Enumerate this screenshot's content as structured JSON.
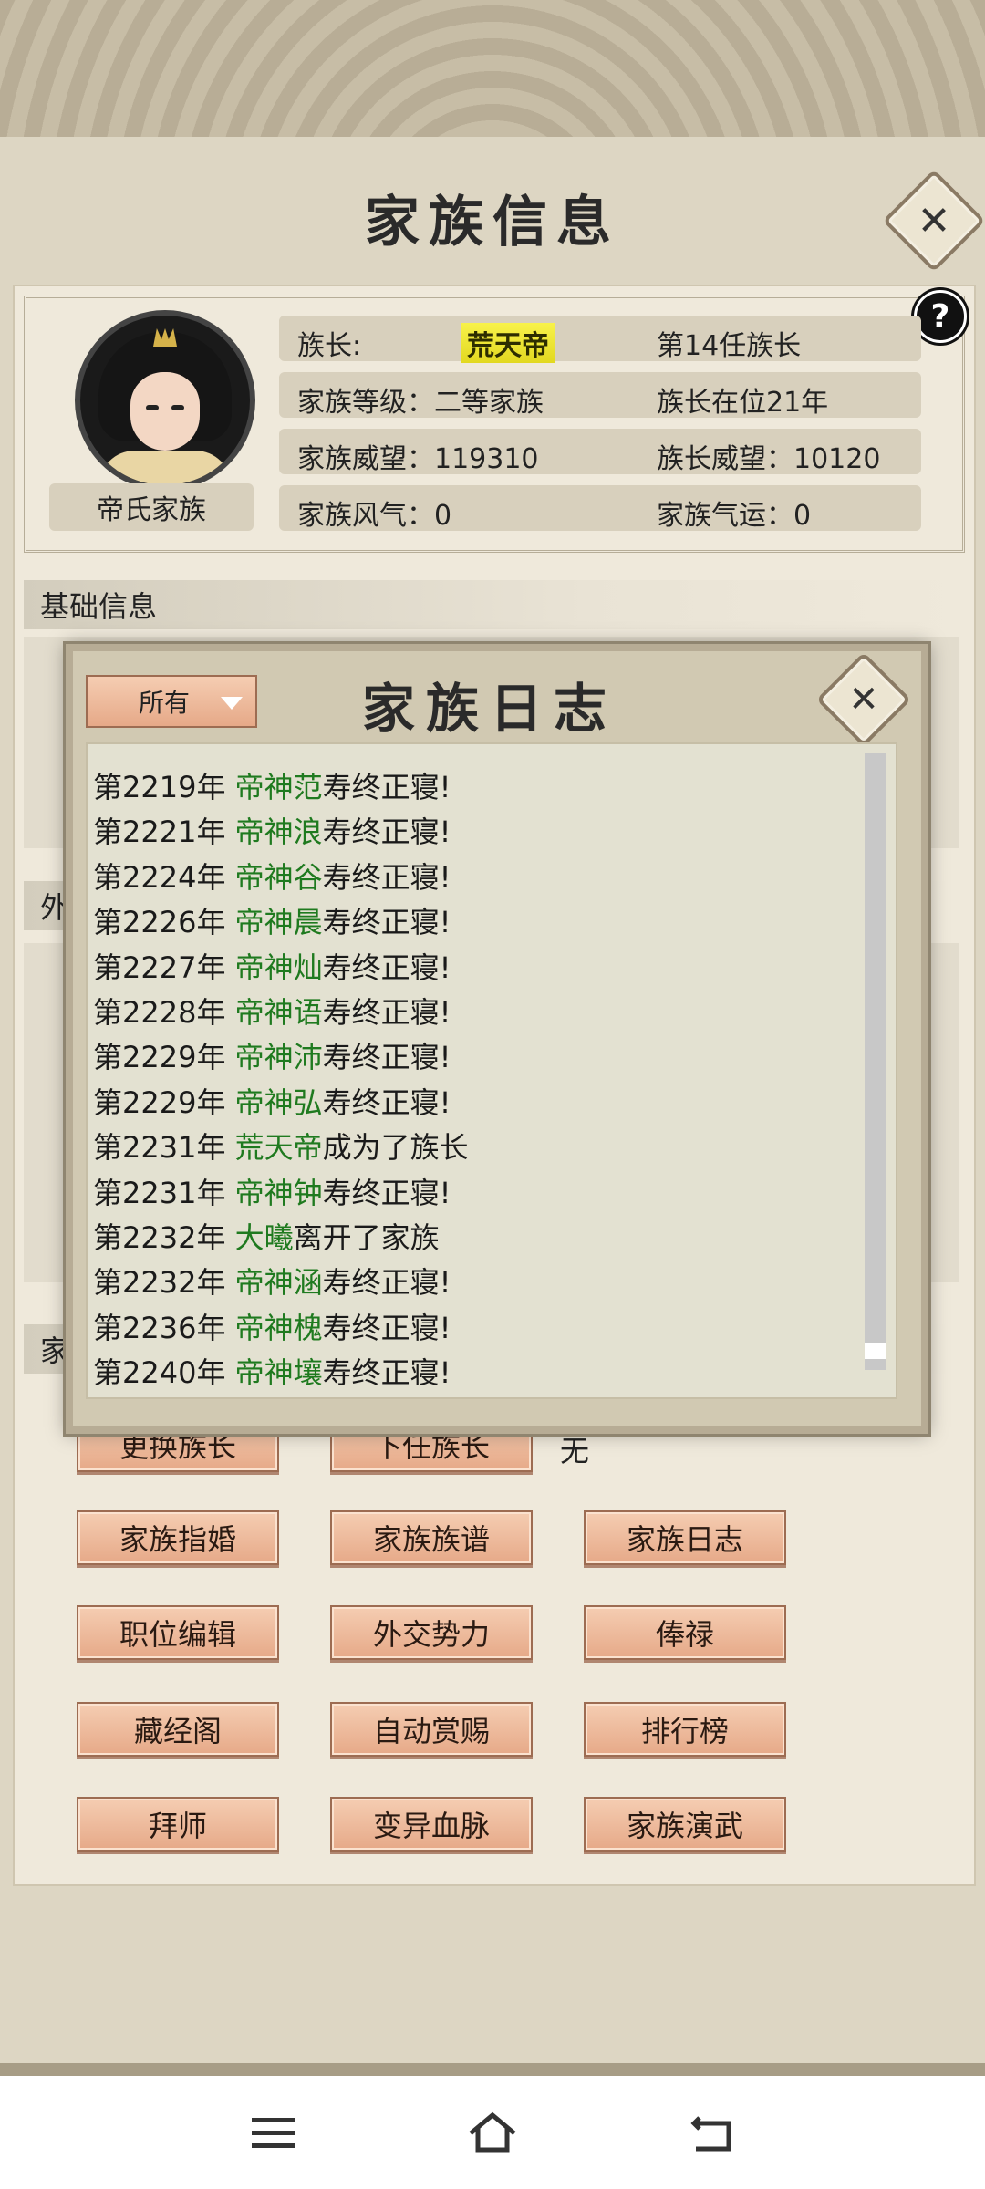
{
  "window": {
    "title": "家族信息"
  },
  "family": {
    "name": "帝氏家族",
    "rows": [
      {
        "left": "族长:",
        "leader": "荒天帝",
        "right": "第14任族长"
      },
      {
        "left": "家族等级：二等家族",
        "right": "族长在位21年"
      },
      {
        "left": "家族威望：119310",
        "right": "族长威望：10120"
      },
      {
        "left": "家族风气：0",
        "right": "家族气运：0"
      }
    ]
  },
  "sections": {
    "basic": "基础信息",
    "foreign_partial": "外",
    "family_partial": "家"
  },
  "successor": {
    "value": "无"
  },
  "buttons": [
    "更换族长",
    "下任族长",
    "家族指婚",
    "家族族谱",
    "家族日志",
    "职位编辑",
    "外交势力",
    "俸禄",
    "藏经阁",
    "自动赏赐",
    "排行榜",
    "拜师",
    "变异血脉",
    "家族演武"
  ],
  "modal": {
    "title": "家族日志",
    "filter": "所有",
    "entries": [
      {
        "year": "第2219年",
        "name": "帝神范",
        "action": "寿终正寝!"
      },
      {
        "year": "第2221年",
        "name": "帝神浪",
        "action": "寿终正寝!"
      },
      {
        "year": "第2224年",
        "name": "帝神谷",
        "action": "寿终正寝!"
      },
      {
        "year": "第2226年",
        "name": "帝神晨",
        "action": "寿终正寝!"
      },
      {
        "year": "第2227年",
        "name": "帝神灿",
        "action": "寿终正寝!"
      },
      {
        "year": "第2228年",
        "name": "帝神语",
        "action": "寿终正寝!"
      },
      {
        "year": "第2229年",
        "name": "帝神沛",
        "action": "寿终正寝!"
      },
      {
        "year": "第2229年",
        "name": "帝神弘",
        "action": "寿终正寝!"
      },
      {
        "year": "第2231年",
        "name": "荒天帝",
        "action": "成为了族长"
      },
      {
        "year": "第2231年",
        "name": "帝神钟",
        "action": "寿终正寝!"
      },
      {
        "year": "第2232年",
        "name": "大曦",
        "action": "离开了家族"
      },
      {
        "year": "第2232年",
        "name": "帝神涵",
        "action": "寿终正寝!"
      },
      {
        "year": "第2236年",
        "name": "帝神槐",
        "action": "寿终正寝!"
      },
      {
        "year": "第2240年",
        "name": "帝神壤",
        "action": "寿终正寝!"
      }
    ]
  },
  "icons": {
    "close": "close-icon",
    "help": "?",
    "nav": [
      "menu-icon",
      "home-icon",
      "back-icon"
    ]
  },
  "colors": {
    "name_green": "#1f7a1f",
    "leader_highlight": "#f3ec35",
    "button": "#eebb9c"
  }
}
